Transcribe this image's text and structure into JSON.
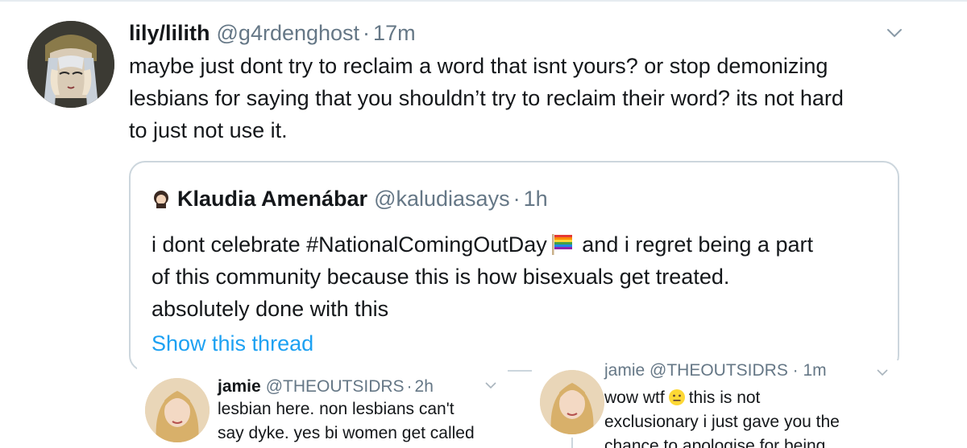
{
  "main_tweet": {
    "name": "lily/lilith",
    "handle": "@g4rdenghost",
    "separator": "·",
    "time": "17m",
    "avatar_icon": "anime-avatar",
    "lines": [
      "maybe just dont try to reclaim a word that isnt yours? or stop demonizing",
      "lesbians for saying that you shouldn’t try to reclaim their word? its not hard",
      "to just not use it."
    ]
  },
  "quoted_tweet": {
    "name": "Klaudia Amenábar",
    "handle": "@kaludiasays",
    "separator": "·",
    "time": "1h",
    "line1_a": "i dont celebrate #NationalComingOutDay",
    "line1_b": " and i regret being a part",
    "line2": "of this community because this is how bisexuals get treated.",
    "line3": "absolutely done with this",
    "flag_icon": "rainbow-flag-icon",
    "show_thread": "Show this thread"
  },
  "screenshot_left": {
    "name": "jamie",
    "handle": "@THEOUTSIDRS",
    "separator": "·",
    "time": "2h",
    "lines": [
      "lesbian here. non lesbians can't",
      "say dyke. yes bi women get called"
    ]
  },
  "screenshot_right": {
    "header_partial": "jamie @THEOUTSIDRS · 1m",
    "line1_a": "wow wtf",
    "line1_b": "this is not",
    "line2": "exclusionary i just gave you the",
    "line3": "chance to apologise for being"
  },
  "colors": {
    "text": "#14171a",
    "secondary": "#657786",
    "link": "#1da1f2",
    "border": "#ccd6dd"
  }
}
